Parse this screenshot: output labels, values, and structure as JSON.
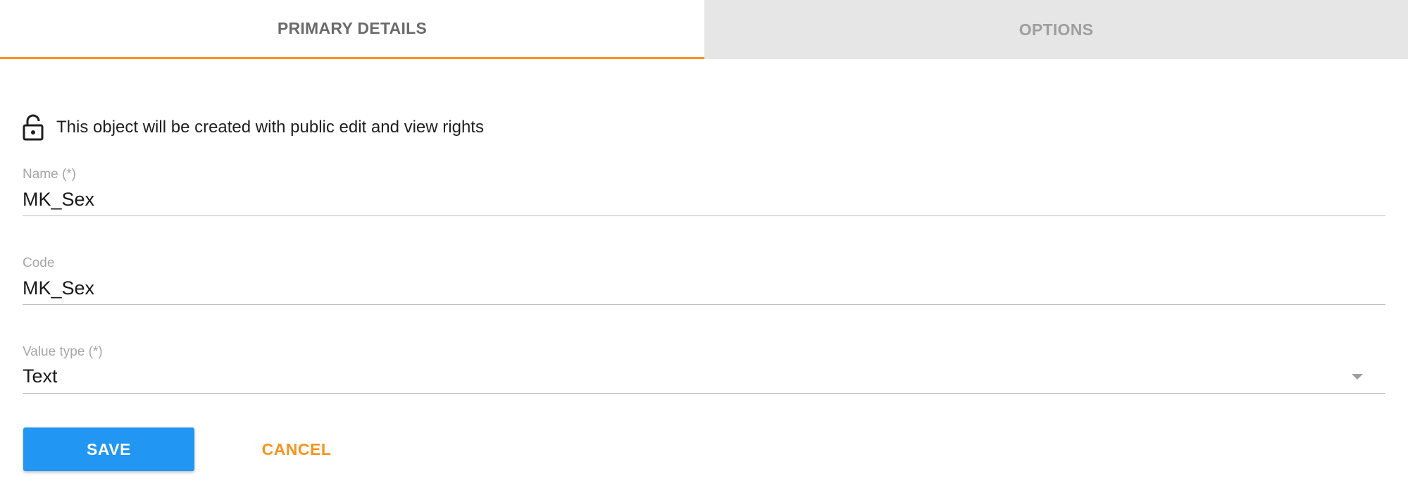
{
  "tabs": [
    {
      "label": "PRIMARY DETAILS",
      "active": true
    },
    {
      "label": "OPTIONS",
      "active": false
    }
  ],
  "rights": {
    "icon": "lock-open-icon",
    "text": "This object will be created with public edit and view rights"
  },
  "form": {
    "name": {
      "label": "Name (*)",
      "value": "MK_Sex"
    },
    "code": {
      "label": "Code",
      "value": "MK_Sex"
    },
    "value_type": {
      "label": "Value type (*)",
      "value": "Text",
      "icon": "dropdown-arrow-icon"
    }
  },
  "actions": {
    "save_label": "SAVE",
    "cancel_label": "CANCEL"
  },
  "colors": {
    "accent": "#f7941d",
    "primary": "#2196f3",
    "tab_inactive_bg": "#e6e6e6"
  }
}
